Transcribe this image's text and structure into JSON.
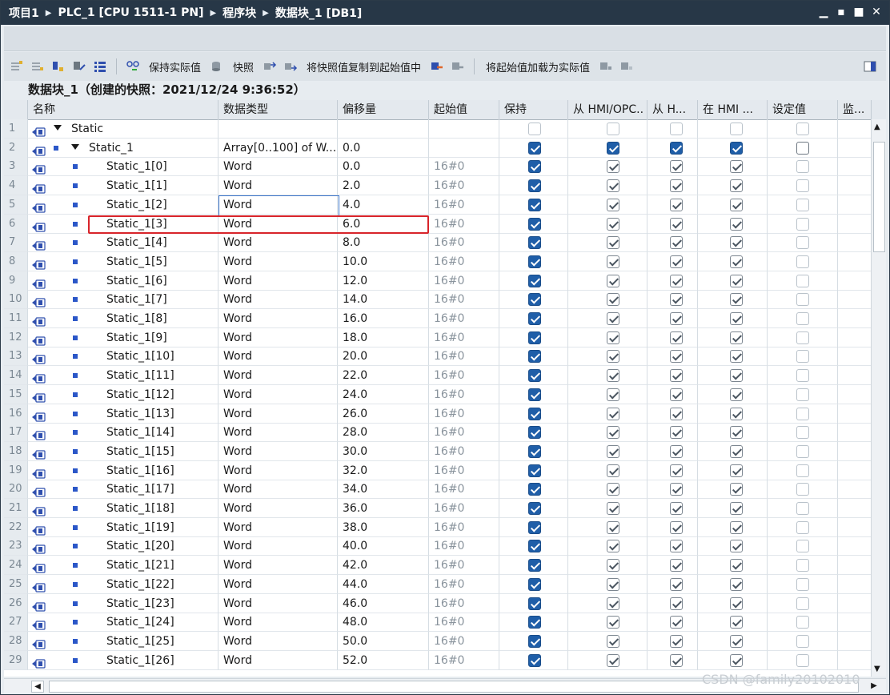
{
  "window": {
    "breadcrumb": [
      "项目1",
      "PLC_1 [CPU 1511-1 PN]",
      "程序块",
      "数据块_1 [DB1]"
    ],
    "controls": {
      "minimize": "▁",
      "restore": "▪",
      "maximize": "■",
      "close": "✕"
    }
  },
  "toolbar": {
    "keep_actual_values": "保持实际值",
    "snapshot": "快照",
    "copy_snapshot_to_start": "将快照值复制到起始值中",
    "load_start_as_actual": "将起始值加载为实际值"
  },
  "snapshot_title": "数据块_1（创建的快照：2021/12/24 9:36:52）",
  "columns": [
    "名称",
    "数据类型",
    "偏移量",
    "起始值",
    "保持",
    "从 HMI/OPC..",
    "从 H...",
    "在 HMI ...",
    "设定值",
    "监..."
  ],
  "rows": [
    {
      "num": "1",
      "name": "Static",
      "type": "",
      "offset": "",
      "start": "",
      "level": 0,
      "expand": true,
      "bullet": false
    },
    {
      "num": "2",
      "name": "Static_1",
      "type": "Array[0..100] of W...",
      "offset": "0.0",
      "start": "",
      "level": 1,
      "expand": true,
      "bullet": true
    },
    {
      "num": "3",
      "name": "Static_1[0]",
      "type": "Word",
      "offset": "0.0",
      "start": "16#0",
      "level": 2
    },
    {
      "num": "4",
      "name": "Static_1[1]",
      "type": "Word",
      "offset": "2.0",
      "start": "16#0",
      "level": 2
    },
    {
      "num": "5",
      "name": "Static_1[2]",
      "type": "Word",
      "offset": "4.0",
      "start": "16#0",
      "level": 2
    },
    {
      "num": "6",
      "name": "Static_1[3]",
      "type": "Word",
      "offset": "6.0",
      "start": "16#0",
      "level": 2
    },
    {
      "num": "7",
      "name": "Static_1[4]",
      "type": "Word",
      "offset": "8.0",
      "start": "16#0",
      "level": 2
    },
    {
      "num": "8",
      "name": "Static_1[5]",
      "type": "Word",
      "offset": "10.0",
      "start": "16#0",
      "level": 2
    },
    {
      "num": "9",
      "name": "Static_1[6]",
      "type": "Word",
      "offset": "12.0",
      "start": "16#0",
      "level": 2
    },
    {
      "num": "10",
      "name": "Static_1[7]",
      "type": "Word",
      "offset": "14.0",
      "start": "16#0",
      "level": 2
    },
    {
      "num": "11",
      "name": "Static_1[8]",
      "type": "Word",
      "offset": "16.0",
      "start": "16#0",
      "level": 2
    },
    {
      "num": "12",
      "name": "Static_1[9]",
      "type": "Word",
      "offset": "18.0",
      "start": "16#0",
      "level": 2
    },
    {
      "num": "13",
      "name": "Static_1[10]",
      "type": "Word",
      "offset": "20.0",
      "start": "16#0",
      "level": 2
    },
    {
      "num": "14",
      "name": "Static_1[11]",
      "type": "Word",
      "offset": "22.0",
      "start": "16#0",
      "level": 2
    },
    {
      "num": "15",
      "name": "Static_1[12]",
      "type": "Word",
      "offset": "24.0",
      "start": "16#0",
      "level": 2
    },
    {
      "num": "16",
      "name": "Static_1[13]",
      "type": "Word",
      "offset": "26.0",
      "start": "16#0",
      "level": 2
    },
    {
      "num": "17",
      "name": "Static_1[14]",
      "type": "Word",
      "offset": "28.0",
      "start": "16#0",
      "level": 2
    },
    {
      "num": "18",
      "name": "Static_1[15]",
      "type": "Word",
      "offset": "30.0",
      "start": "16#0",
      "level": 2
    },
    {
      "num": "19",
      "name": "Static_1[16]",
      "type": "Word",
      "offset": "32.0",
      "start": "16#0",
      "level": 2
    },
    {
      "num": "20",
      "name": "Static_1[17]",
      "type": "Word",
      "offset": "34.0",
      "start": "16#0",
      "level": 2
    },
    {
      "num": "21",
      "name": "Static_1[18]",
      "type": "Word",
      "offset": "36.0",
      "start": "16#0",
      "level": 2
    },
    {
      "num": "22",
      "name": "Static_1[19]",
      "type": "Word",
      "offset": "38.0",
      "start": "16#0",
      "level": 2
    },
    {
      "num": "23",
      "name": "Static_1[20]",
      "type": "Word",
      "offset": "40.0",
      "start": "16#0",
      "level": 2
    },
    {
      "num": "24",
      "name": "Static_1[21]",
      "type": "Word",
      "offset": "42.0",
      "start": "16#0",
      "level": 2
    },
    {
      "num": "25",
      "name": "Static_1[22]",
      "type": "Word",
      "offset": "44.0",
      "start": "16#0",
      "level": 2
    },
    {
      "num": "26",
      "name": "Static_1[23]",
      "type": "Word",
      "offset": "46.0",
      "start": "16#0",
      "level": 2
    },
    {
      "num": "27",
      "name": "Static_1[24]",
      "type": "Word",
      "offset": "48.0",
      "start": "16#0",
      "level": 2
    },
    {
      "num": "28",
      "name": "Static_1[25]",
      "type": "Word",
      "offset": "50.0",
      "start": "16#0",
      "level": 2
    },
    {
      "num": "29",
      "name": "Static_1[26]",
      "type": "Word",
      "offset": "52.0",
      "start": "16#0",
      "level": 2
    }
  ],
  "watermark": "CSDN @family20102010",
  "colors": {
    "title_bar": "#273747",
    "checkbox_on": "#1f5ea8",
    "highlight_outline": "#d8242a",
    "selection_outline": "#3b74c9",
    "bullet": "#2b57c8"
  }
}
